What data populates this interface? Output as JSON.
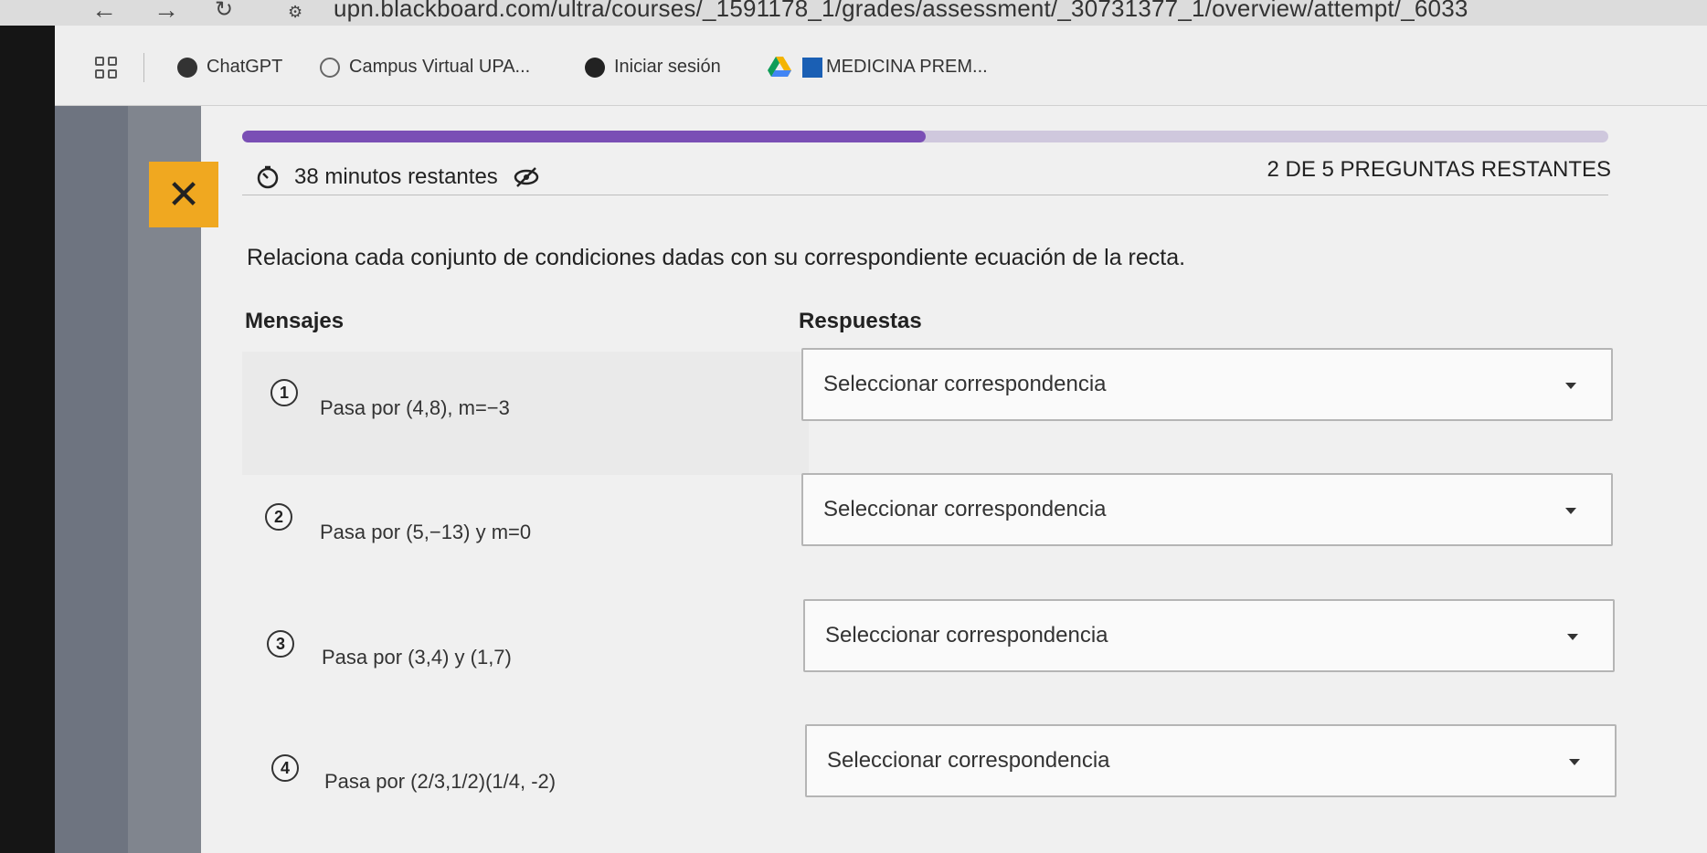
{
  "browser": {
    "url": "upn.blackboard.com/ultra/courses/_1591178_1/grades/assessment/_30731377_1/overview/attempt/_6033",
    "bookmarks": [
      {
        "label": "ChatGPT",
        "icon": "chatgpt-icon"
      },
      {
        "label": "Campus Virtual UPA...",
        "icon": "campus-icon"
      },
      {
        "label": "Iniciar sesión",
        "icon": "globe-icon"
      },
      {
        "label": "",
        "icon": "google-drive-icon"
      },
      {
        "label": "MEDICINA PREM...",
        "icon": "medicina-icon"
      }
    ]
  },
  "assessment": {
    "progress_fraction": 0.5,
    "timer_text": "38 minutos restantes",
    "remaining_text": "2 DE 5 PREGUNTAS RESTANTES",
    "instruction": "Relaciona cada conjunto de condiciones dadas con su correspondiente ecuación de la recta.",
    "col_messages": "Mensajes",
    "col_answers": "Respuestas",
    "items": [
      {
        "number": "1",
        "message": "Pasa por (4,8), m=−3",
        "select_label": "Seleccionar correspondencia"
      },
      {
        "number": "2",
        "message": "Pasa por (5,−13) y m=0",
        "select_label": "Seleccionar correspondencia"
      },
      {
        "number": "3",
        "message": "Pasa por (3,4) y (1,7)",
        "select_label": "Seleccionar correspondencia"
      },
      {
        "number": "4",
        "message": "Pasa por (2/3,1/2)(1/4, -2)",
        "select_label": "Seleccionar correspondencia"
      }
    ]
  },
  "colors": {
    "accent": "#7a4fb5",
    "close_button": "#f0a820"
  }
}
